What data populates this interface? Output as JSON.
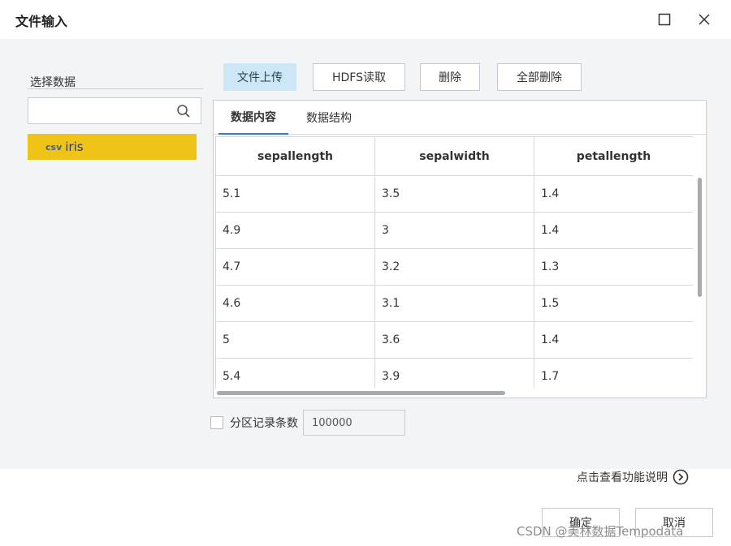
{
  "window": {
    "title": "文件输入",
    "maximize_icon": "maximize-icon",
    "close_icon": "close-icon"
  },
  "sidebar": {
    "label": "选择数据",
    "search": {
      "value": "",
      "placeholder": "",
      "icon": "search-icon"
    },
    "files": [
      {
        "type": "csv",
        "name": "iris",
        "selected": true
      }
    ]
  },
  "toolbar": {
    "upload_label": "文件上传",
    "hdfs_label": "HDFS读取",
    "delete_label": "删除",
    "delete_all_label": "全部删除"
  },
  "tabs": [
    {
      "label": "数据内容",
      "active": true
    },
    {
      "label": "数据结构",
      "active": false
    }
  ],
  "table": {
    "columns": [
      "sepallength",
      "sepalwidth",
      "petallength"
    ],
    "rows": [
      [
        "5.1",
        "3.5",
        "1.4"
      ],
      [
        "4.9",
        "3",
        "1.4"
      ],
      [
        "4.7",
        "3.2",
        "1.3"
      ],
      [
        "4.6",
        "3.1",
        "1.5"
      ],
      [
        "5",
        "3.6",
        "1.4"
      ],
      [
        "5.4",
        "3.9",
        "1.7"
      ]
    ]
  },
  "partition": {
    "checked": false,
    "label": "分区记录条数",
    "value": "100000"
  },
  "help": {
    "label": "点击查看功能说明",
    "icon": "chevron-right-circle-icon"
  },
  "footer": {
    "confirm_label": "确定",
    "cancel_label": "取消"
  },
  "watermark": "CSDN @美林数据Tempodata",
  "colors": {
    "selected_file_bg": "#f0c416",
    "primary_button_bg": "#cde6f8",
    "active_tab_underline": "#2d7fd0",
    "body_bg": "#f3f4f6"
  }
}
